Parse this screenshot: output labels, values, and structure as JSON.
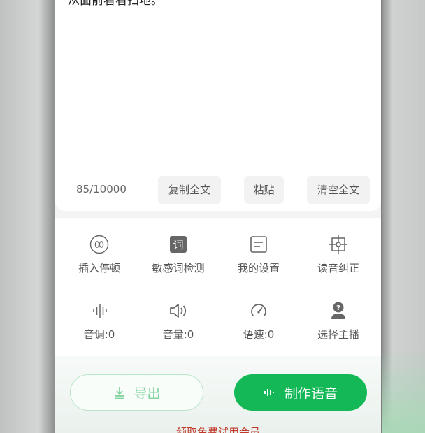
{
  "editor": {
    "text": "从面前看看扫地。",
    "counter": "85/10000",
    "actions": [
      "复制全文",
      "粘贴",
      "清空全文"
    ]
  },
  "tools": [
    {
      "label": "插入停顿",
      "icon": "pause-circle-icon"
    },
    {
      "label": "敏感词检测",
      "icon": "sensitive-word-icon"
    },
    {
      "label": "我的设置",
      "icon": "settings-document-icon"
    },
    {
      "label": "读音纠正",
      "icon": "pronunciation-target-icon"
    },
    {
      "label": "音调:0",
      "icon": "waveform-icon"
    },
    {
      "label": "音量:0",
      "icon": "speaker-icon"
    },
    {
      "label": "语速:0",
      "icon": "speedometer-icon"
    },
    {
      "label": "选择主播",
      "icon": "anchor-person-icon"
    }
  ],
  "buttons": {
    "export": "导出",
    "make": "制作语音"
  },
  "promo": "领取免费试用会员",
  "colors": {
    "accent": "#15b857",
    "accent_light": "#7fd39c",
    "promo": "#c0392b"
  }
}
